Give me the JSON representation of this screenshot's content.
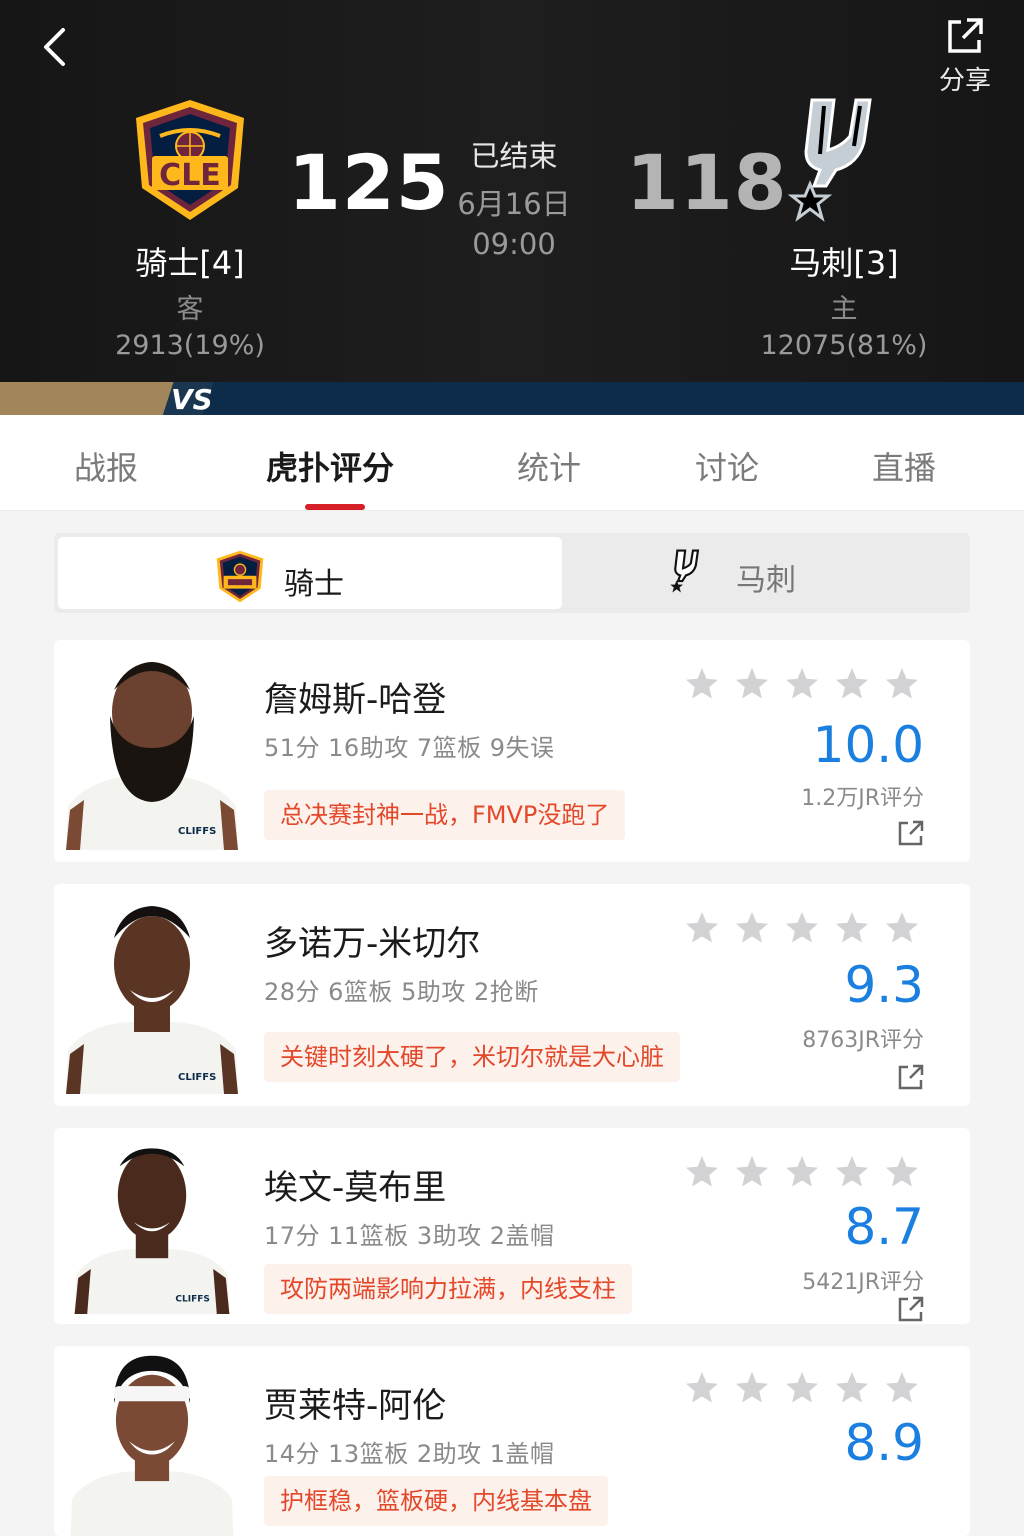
{
  "header": {
    "share_label": "分享",
    "status": "已结束",
    "date": "6月16日",
    "time": "09:00",
    "vs_text": "VS",
    "away": {
      "name": "骑士[4]",
      "side": "客",
      "votes": "2913(19%)",
      "score": "125",
      "logo_text": "CLE"
    },
    "home": {
      "name": "马刺[3]",
      "side": "主",
      "votes": "12075(81%)",
      "score": "118"
    }
  },
  "tabs": [
    "战报",
    "虎扑评分",
    "统计",
    "讨论",
    "直播"
  ],
  "active_tab": "虎扑评分",
  "team_switch": {
    "left": "骑士",
    "right": "马刺",
    "selected": "骑士"
  },
  "players": [
    {
      "name": "詹姆斯-哈登",
      "stats": "51分 16助攻 7篮板 9失误",
      "comment": "总决赛封神一战，FMVP没跑了",
      "score": "10.0",
      "votes": "1.2万JR评分",
      "jersey": "CLIFFS"
    },
    {
      "name": "多诺万-米切尔",
      "stats": "28分 6篮板 5助攻 2抢断",
      "comment": "关键时刻太硬了，米切尔就是大心脏",
      "score": "9.3",
      "votes": "8763JR评分",
      "jersey": "CLIFFS"
    },
    {
      "name": "埃文-莫布里",
      "stats": "17分 11篮板 3助攻 2盖帽",
      "comment": "攻防两端影响力拉满，内线支柱",
      "score": "8.7",
      "votes": "5421JR评分",
      "jersey": "CLIFFS"
    },
    {
      "name": "贾莱特-阿伦",
      "stats": "14分 13篮板 2助攻 1盖帽",
      "comment": "护框稳，篮板硬，内线基本盘",
      "score": "8.9",
      "votes": "",
      "jersey": ""
    }
  ],
  "colors": {
    "accent_blue": "#1a7fde",
    "tab_indicator": "#d61f26",
    "comment_text": "#e4482a",
    "cavs_wine": "#6f263d",
    "cavs_gold": "#ffb81c",
    "spurs_silver": "#c4ced4"
  }
}
